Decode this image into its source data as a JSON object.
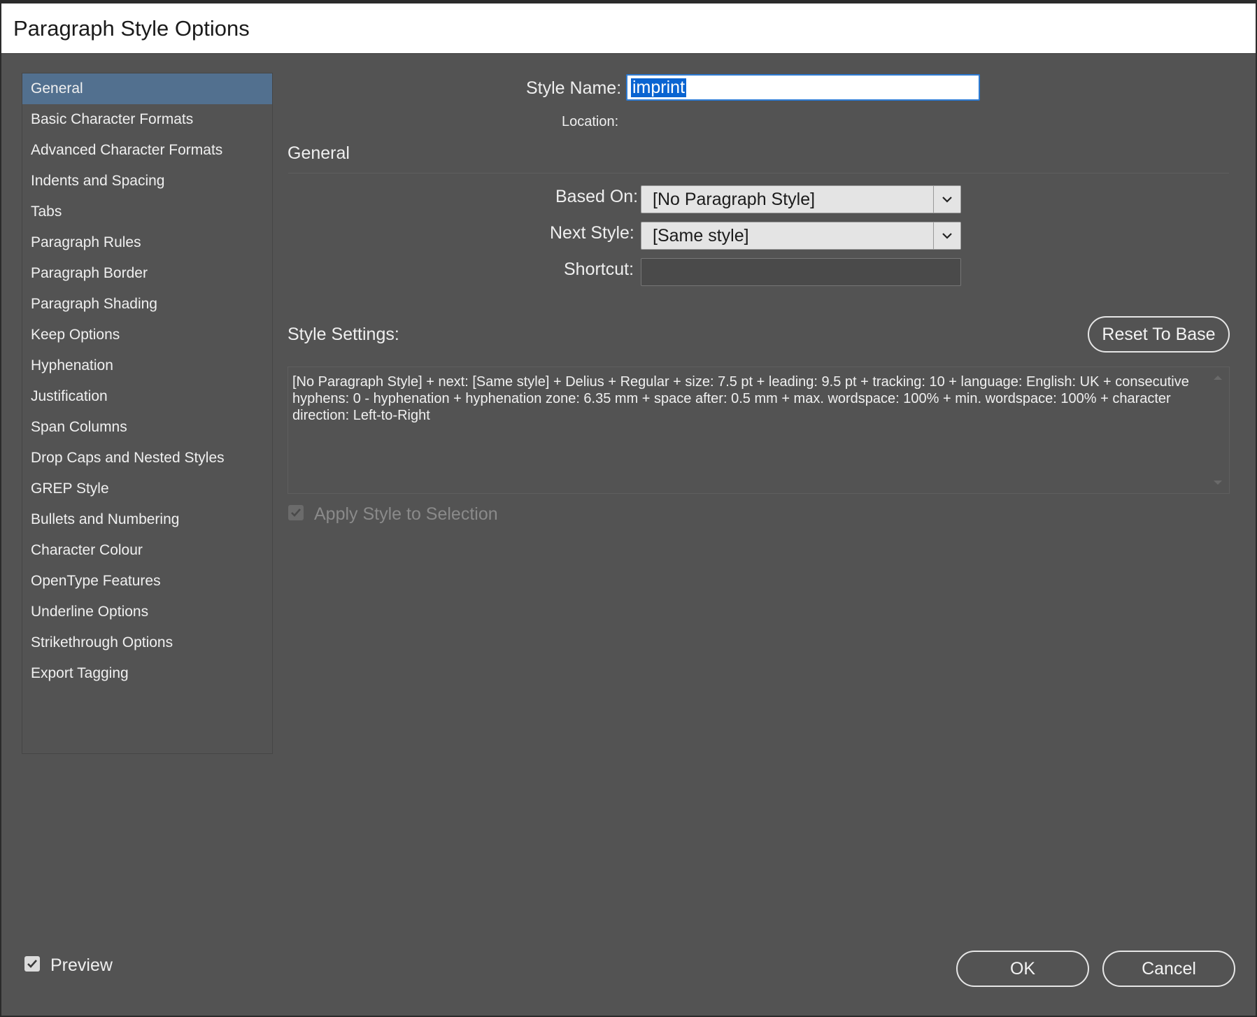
{
  "dialog": {
    "title": "Paragraph Style Options"
  },
  "sidebar": {
    "items": [
      {
        "label": "General",
        "selected": true
      },
      {
        "label": "Basic Character Formats"
      },
      {
        "label": "Advanced Character Formats"
      },
      {
        "label": "Indents and Spacing"
      },
      {
        "label": "Tabs"
      },
      {
        "label": "Paragraph Rules"
      },
      {
        "label": "Paragraph Border"
      },
      {
        "label": "Paragraph Shading"
      },
      {
        "label": "Keep Options"
      },
      {
        "label": "Hyphenation"
      },
      {
        "label": "Justification"
      },
      {
        "label": "Span Columns"
      },
      {
        "label": "Drop Caps and Nested Styles"
      },
      {
        "label": "GREP Style"
      },
      {
        "label": "Bullets and Numbering"
      },
      {
        "label": "Character Colour"
      },
      {
        "label": "OpenType Features"
      },
      {
        "label": "Underline Options"
      },
      {
        "label": "Strikethrough Options"
      },
      {
        "label": "Export Tagging"
      }
    ]
  },
  "general": {
    "style_name_label": "Style Name:",
    "style_name_value": "imprint",
    "location_label": "Location:",
    "section_heading": "General",
    "based_on_label": "Based On:",
    "based_on_value": "[No Paragraph Style]",
    "next_style_label": "Next Style:",
    "next_style_value": "[Same style]",
    "shortcut_label": "Shortcut:",
    "shortcut_value": "",
    "style_settings_label": "Style Settings:",
    "reset_button": "Reset To Base",
    "style_settings_text": "[No Paragraph Style] + next: [Same style] + Delius + Regular + size: 7.5 pt + leading: 9.5 pt + tracking: 10 + language: English: UK + consecutive hyphens: 0 - hyphenation + hyphenation zone:  6.35 mm + space after: 0.5 mm + max. wordspace: 100% + min. wordspace: 100% + character direction: Left-to-Right",
    "apply_style_label": "Apply Style to Selection",
    "apply_style_checked": true,
    "apply_style_enabled": false
  },
  "footer": {
    "preview_label": "Preview",
    "preview_checked": true,
    "ok_button": "OK",
    "cancel_button": "Cancel"
  },
  "colors": {
    "dialog_bg": "#535353",
    "sidebar_selected": "#52708f",
    "text_selection": "#0a64d1",
    "focus_border": "#2d7bd4"
  },
  "icons": [
    "chevron-down-icon",
    "checkmark-icon"
  ]
}
